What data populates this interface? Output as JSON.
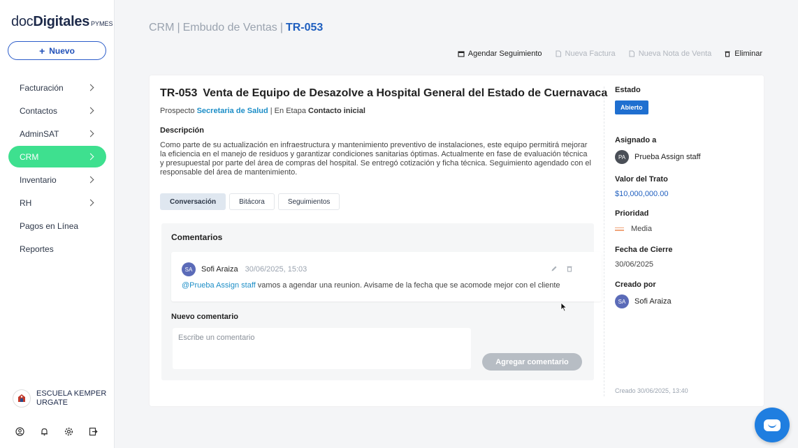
{
  "brand": {
    "doc": "doc",
    "digitales": "Digitales",
    "pymes": "PYMES"
  },
  "sidebar": {
    "new_button": "Nuevo",
    "items": [
      {
        "label": "Facturación",
        "chevron": true
      },
      {
        "label": "Contactos",
        "chevron": true
      },
      {
        "label": "AdminSAT",
        "chevron": true
      },
      {
        "label": "CRM",
        "chevron": true,
        "active": true
      },
      {
        "label": "Inventario",
        "chevron": true
      },
      {
        "label": "RH",
        "chevron": true
      },
      {
        "label": "Pagos en Línea",
        "chevron": false
      },
      {
        "label": "Reportes",
        "chevron": false
      }
    ],
    "company_line1": "ESCUELA KEMPER",
    "company_line2": "URGATE",
    "footer_icons": [
      "user-circle-icon",
      "bell-icon",
      "gear-icon",
      "logout-icon"
    ]
  },
  "breadcrumb": {
    "part1": "CRM",
    "part2": "Embudo de Ventas",
    "current": "TR-053"
  },
  "actions": {
    "schedule": "Agendar Seguimiento",
    "invoice": "Nueva Factura",
    "sale_note": "Nueva Nota de Venta",
    "delete": "Eliminar"
  },
  "deal": {
    "code": "TR-053",
    "title": "Venta de Equipo de Desazolve a Hospital General del Estado de Cuernavaca",
    "prospect_label": "Prospecto",
    "prospect_name": "Secretaria de Salud",
    "stage_label": "| En Etapa",
    "stage": "Contacto inicial",
    "description_label": "Descripción",
    "description": "Como parte de su actualización en infraestructura y mantenimiento preventivo de instalaciones, este equipo permitirá mejorar la eficiencia en el manejo de residuos y garantizar condiciones sanitarias óptimas. Actualmente en fase de evaluación técnica y presupuestal por parte del área de compras del hospital. Se entregó cotización y ficha técnica. Seguimiento agendado con el responsable del área de mantenimiento."
  },
  "tabs": [
    "Conversación",
    "Bitácora",
    "Seguimientos"
  ],
  "conversation": {
    "title": "Comentarios",
    "comment": {
      "initials": "SA",
      "author": "Sofi Araiza",
      "date": "30/06/2025, 15:03",
      "mention": "@Prueba Assign staff",
      "text": " vamos a agendar una reunion. Avisame de la fecha que se acomode mejor con el cliente"
    },
    "new_label": "Nuevo comentario",
    "placeholder": "Escribe un comentario",
    "add_button": "Agregar comentario"
  },
  "details": {
    "status_label": "Estado",
    "status": "Abierto",
    "assigned_label": "Asignado a",
    "assigned_initials": "PA",
    "assigned_name": "Prueba Assign staff",
    "value_label": "Valor del Trato",
    "value": "$10,000,000.00",
    "priority_label": "Prioridad",
    "priority": "Media",
    "close_label": "Fecha de Cierre",
    "close_date": "30/06/2025",
    "created_by_label": "Creado por",
    "creator_initials": "SA",
    "creator_name": "Sofi Araiza",
    "created_footer": "Creado 30/06/2025, 13:40"
  },
  "colors": {
    "accent": "#3ee08f",
    "link": "#1d8ec7",
    "primary": "#1f6fd0"
  }
}
